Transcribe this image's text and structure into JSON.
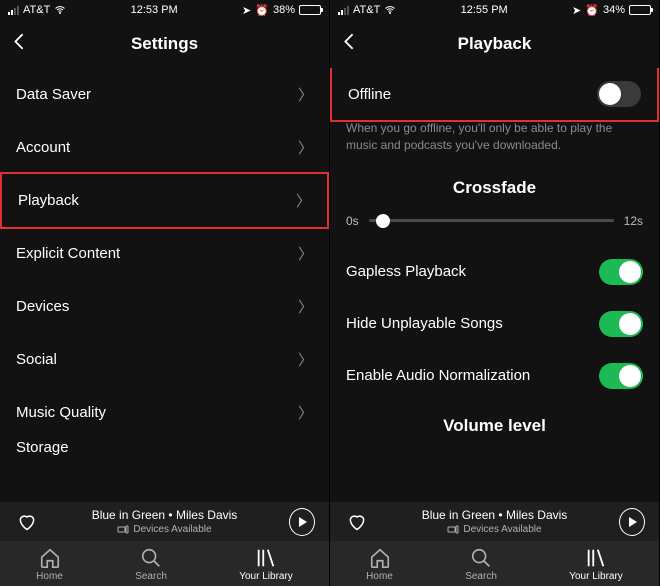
{
  "left": {
    "status": {
      "carrier": "AT&T",
      "time": "12:53 PM",
      "battery": "38%"
    },
    "header": {
      "title": "Settings"
    },
    "items": [
      {
        "label": "Data Saver"
      },
      {
        "label": "Account"
      },
      {
        "label": "Playback"
      },
      {
        "label": "Explicit Content"
      },
      {
        "label": "Devices"
      },
      {
        "label": "Social"
      },
      {
        "label": "Music Quality"
      },
      {
        "label": "Storage"
      }
    ],
    "nowplaying": {
      "title": "Blue in Green • Miles Davis",
      "sub": "Devices Available"
    },
    "tabs": {
      "home": "Home",
      "search": "Search",
      "library": "Your Library"
    }
  },
  "right": {
    "status": {
      "carrier": "AT&T",
      "time": "12:55 PM",
      "battery": "34%"
    },
    "header": {
      "title": "Playback"
    },
    "offline": {
      "label": "Offline",
      "help": "When you go offline, you'll only be able to play the music and podcasts you've downloaded."
    },
    "crossfade": {
      "title": "Crossfade",
      "min": "0s",
      "max": "12s",
      "pos_pct": 6
    },
    "toggles": [
      {
        "label": "Gapless Playback",
        "on": true
      },
      {
        "label": "Hide Unplayable Songs",
        "on": true
      },
      {
        "label": "Enable Audio Normalization",
        "on": true
      }
    ],
    "volume_title": "Volume level",
    "nowplaying": {
      "title": "Blue in Green • Miles Davis",
      "sub": "Devices Available"
    },
    "tabs": {
      "home": "Home",
      "search": "Search",
      "library": "Your Library"
    }
  }
}
